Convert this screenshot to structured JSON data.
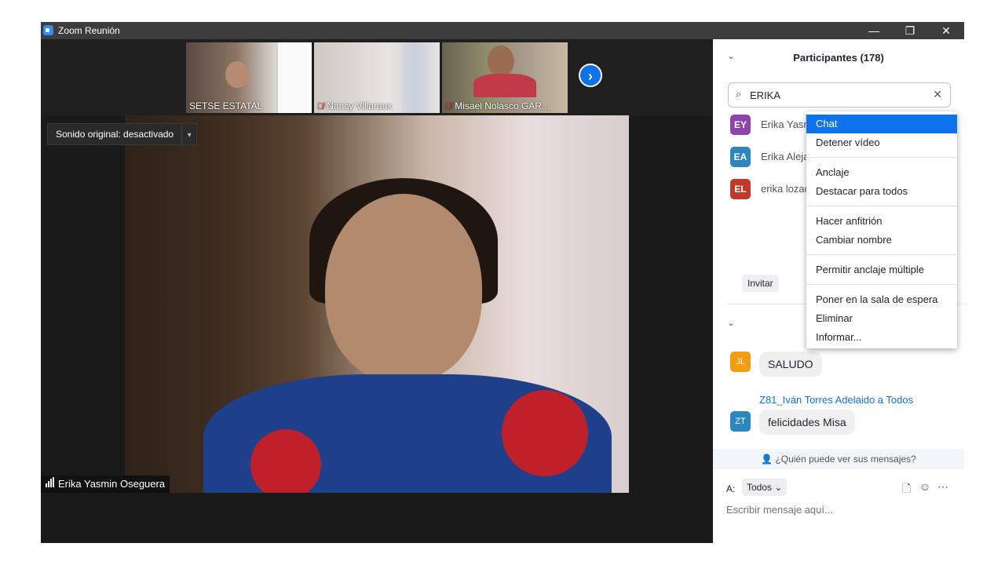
{
  "window": {
    "title": "Zoom Reunión",
    "controls": {
      "minimize": "—",
      "restore": "❐",
      "close": "✕"
    }
  },
  "thumbnails": [
    {
      "label": "SETSE ESTATAL",
      "muted": false
    },
    {
      "label": "Nancy Villaraux",
      "muted": true
    },
    {
      "label": "Misael Nolasco GAR...",
      "muted": true
    }
  ],
  "next_button": "›",
  "audio_toggle": {
    "label": "Sonido original: desactivado",
    "arrow": "▾"
  },
  "active_speaker": {
    "name": "Erika Yasmin Oseguera"
  },
  "participants": {
    "title": "Participantes (178)",
    "chevron": "⌄",
    "search": {
      "value": "ERIKA",
      "clear": "✕"
    },
    "list": [
      {
        "initials": "EY",
        "name": "Erika Yasm",
        "color": "#8e44ad"
      },
      {
        "initials": "EA",
        "name": "Erika Aleja",
        "color": "#2e86c1"
      },
      {
        "initials": "EL",
        "name": "erika lozad",
        "color": "#c0392b"
      }
    ],
    "invite_label": "Invitar"
  },
  "context_menu": {
    "items": [
      "Chat",
      "Detener vídeo",
      "Anclaje",
      "Destacar para todos",
      "Hacer anfitrión",
      "Cambiar nombre",
      "Permitir anclaje múltiple",
      "Poner en la sala de espera",
      "Eliminar",
      "Informar..."
    ],
    "selected": "Chat"
  },
  "chat": {
    "chevron": "⌄",
    "messages": [
      {
        "initials": "JL",
        "color": "#f39c12",
        "text": "SALUDO"
      },
      {
        "sender": "Z81_Iván Torres Adelaido a Todos",
        "initials": "ZT",
        "color": "#2e86c1",
        "text": "felicidades Misa"
      }
    ],
    "who_can_see": "¿Quién puede ver sus mensajes?",
    "to_label": "A:",
    "to_value": "Todos",
    "to_arrow": "⌄",
    "compose_placeholder": "Escribir mensaje aquí...",
    "icons": [
      "file-icon",
      "emoji-icon",
      "more-icon"
    ]
  }
}
